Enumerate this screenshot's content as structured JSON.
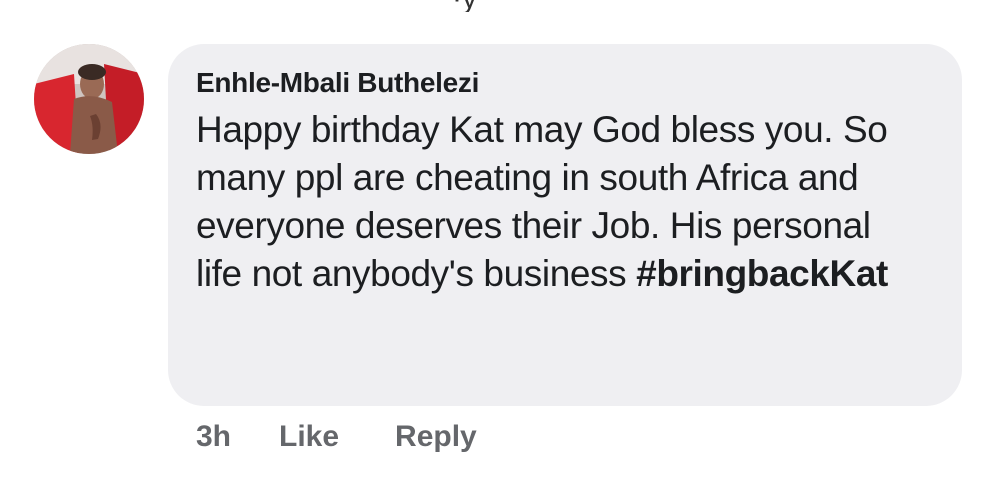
{
  "top_fragment": "·y",
  "comment": {
    "author_name": "Enhle-Mbali Buthelezi",
    "text_main": "Happy birthday Kat may God bless you. So many ppl are cheating in south Africa and everyone deserves their Job. His personal life not anybody's business ",
    "hashtag": "#bringbackKat",
    "timestamp": "3h",
    "like_label": "Like",
    "reply_label": "Reply"
  },
  "colors": {
    "bubble_background": "#efeff2",
    "action_text": "#65676b",
    "text": "#1c1e21"
  }
}
